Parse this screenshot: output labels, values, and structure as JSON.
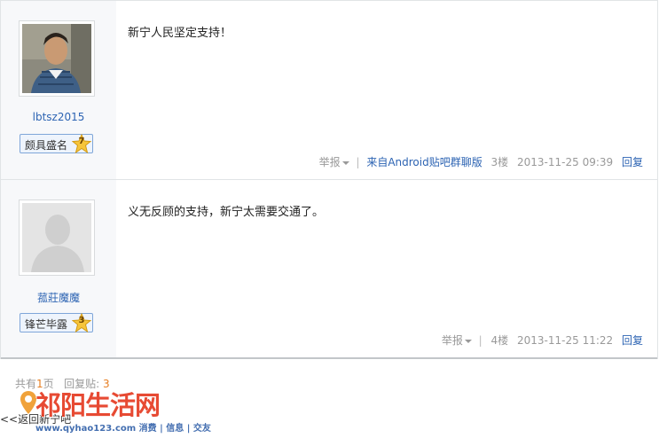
{
  "posts": [
    {
      "username": "lbtsz2015",
      "level_name": "颇具盛名",
      "level_num": "7",
      "content": "新宁人民坚定支持！",
      "report": "举报",
      "client": "来自Android贴吧群聊版",
      "floor": "3楼",
      "time": "2013-11-25 09:39",
      "reply": "回复"
    },
    {
      "username": "菰莊魔魔",
      "level_name": "锋芒毕露",
      "level_num": "3",
      "content": "义无反顾的支持，新宁太需要交通了。",
      "report": "举报",
      "floor": "4楼",
      "time": "2013-11-25 11:22",
      "reply": "回复"
    }
  ],
  "pager": {
    "total_prefix": "共有",
    "pages": "1",
    "pages_suffix": "页",
    "replies_label": "回复贴:",
    "replies": "3"
  },
  "back_link": "<<返回新宁吧",
  "watermark": {
    "title": "祁阳生活网",
    "sub": "www.qyhao123.com 消费 | 信息 | 交友"
  },
  "colors": {
    "link": "#2d64b3",
    "accent": "#e67e22",
    "watermark": "#e53b22"
  }
}
